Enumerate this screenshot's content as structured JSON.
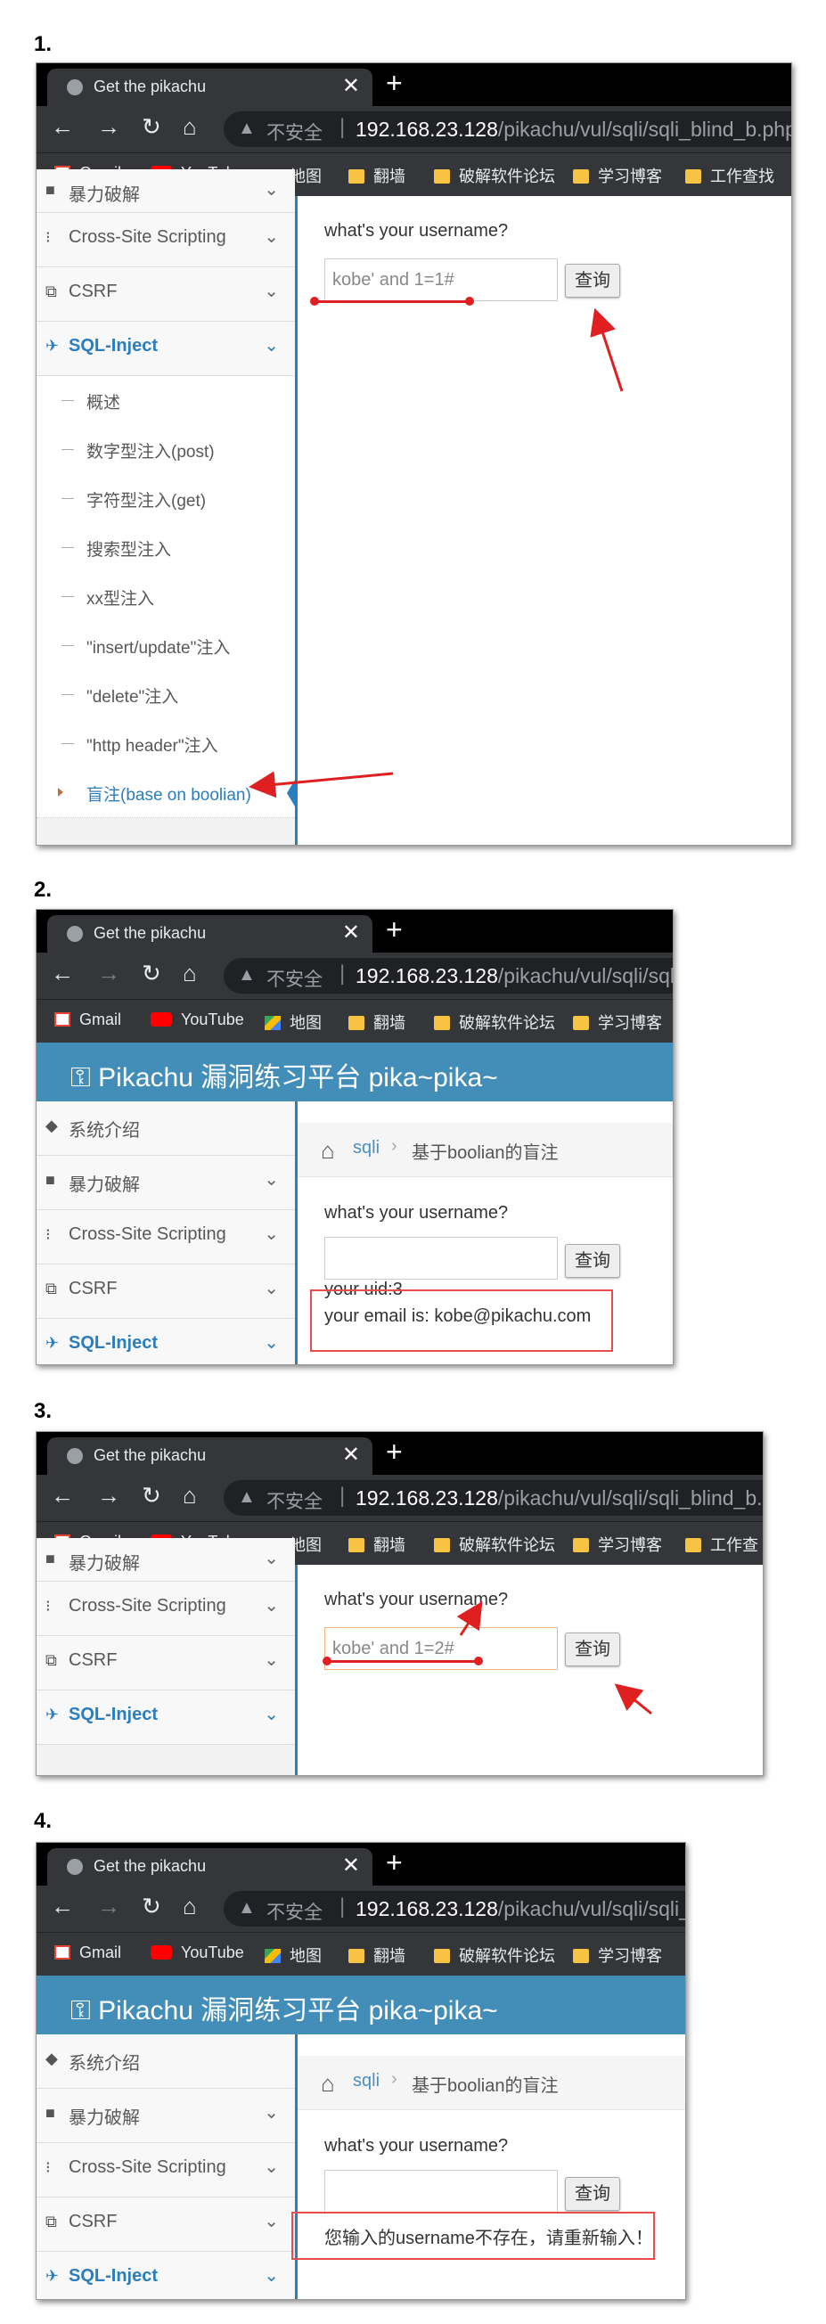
{
  "steps": [
    "1.",
    "2.",
    "3.",
    "4."
  ],
  "browser": {
    "tab_title": "Get the pikachu",
    "insecure_label": "不安全",
    "url_host": "192.168.23.128",
    "url_path_full": "/pikachu/vul/sqli/sqli_blind_b.php",
    "url_path_short": "/pikachu/vul/sqli/sqli",
    "url_path_mid": "/pikachu/vul/sqli/sqli_blind_b.p",
    "url_path_4": "/pikachu/vul/sqli/sqli_b"
  },
  "bookmarks": [
    "Gmail",
    "YouTube",
    "地图",
    "翻墙",
    "破解软件论坛",
    "学习博客",
    "工作查找",
    "工作查"
  ],
  "site": {
    "title": "Pikachu 漏洞练习平台 pika~pika~",
    "breadcrumb_link": "sqli",
    "breadcrumb_current": "基于boolian的盲注",
    "question": "what's your username?",
    "query_button": "查询"
  },
  "sidebar": {
    "intro": "系统介绍",
    "brute": "暴力破解",
    "xss": "Cross-Site Scripting",
    "csrf": "CSRF",
    "sqli": "SQL-Inject",
    "sub": [
      "概述",
      "数字型注入(post)",
      "字符型注入(get)",
      "搜索型注入",
      "xx型注入",
      "\"insert/update\"注入",
      "\"delete\"注入",
      "\"http header\"注入",
      "盲注(base on boolian)"
    ]
  },
  "shot1": {
    "input_value": "kobe' and 1=1#"
  },
  "shot2": {
    "result_uid": "your uid:3",
    "result_email": "your email is: kobe@pikachu.com"
  },
  "shot3": {
    "input_value": "kobe' and 1=2#"
  },
  "shot4": {
    "result_msg": "您输入的username不存在，请重新输入！"
  },
  "colors": {
    "header_blue": "#438eb9",
    "active_blue": "#2b7dbc",
    "annotation_red": "#e02020"
  }
}
